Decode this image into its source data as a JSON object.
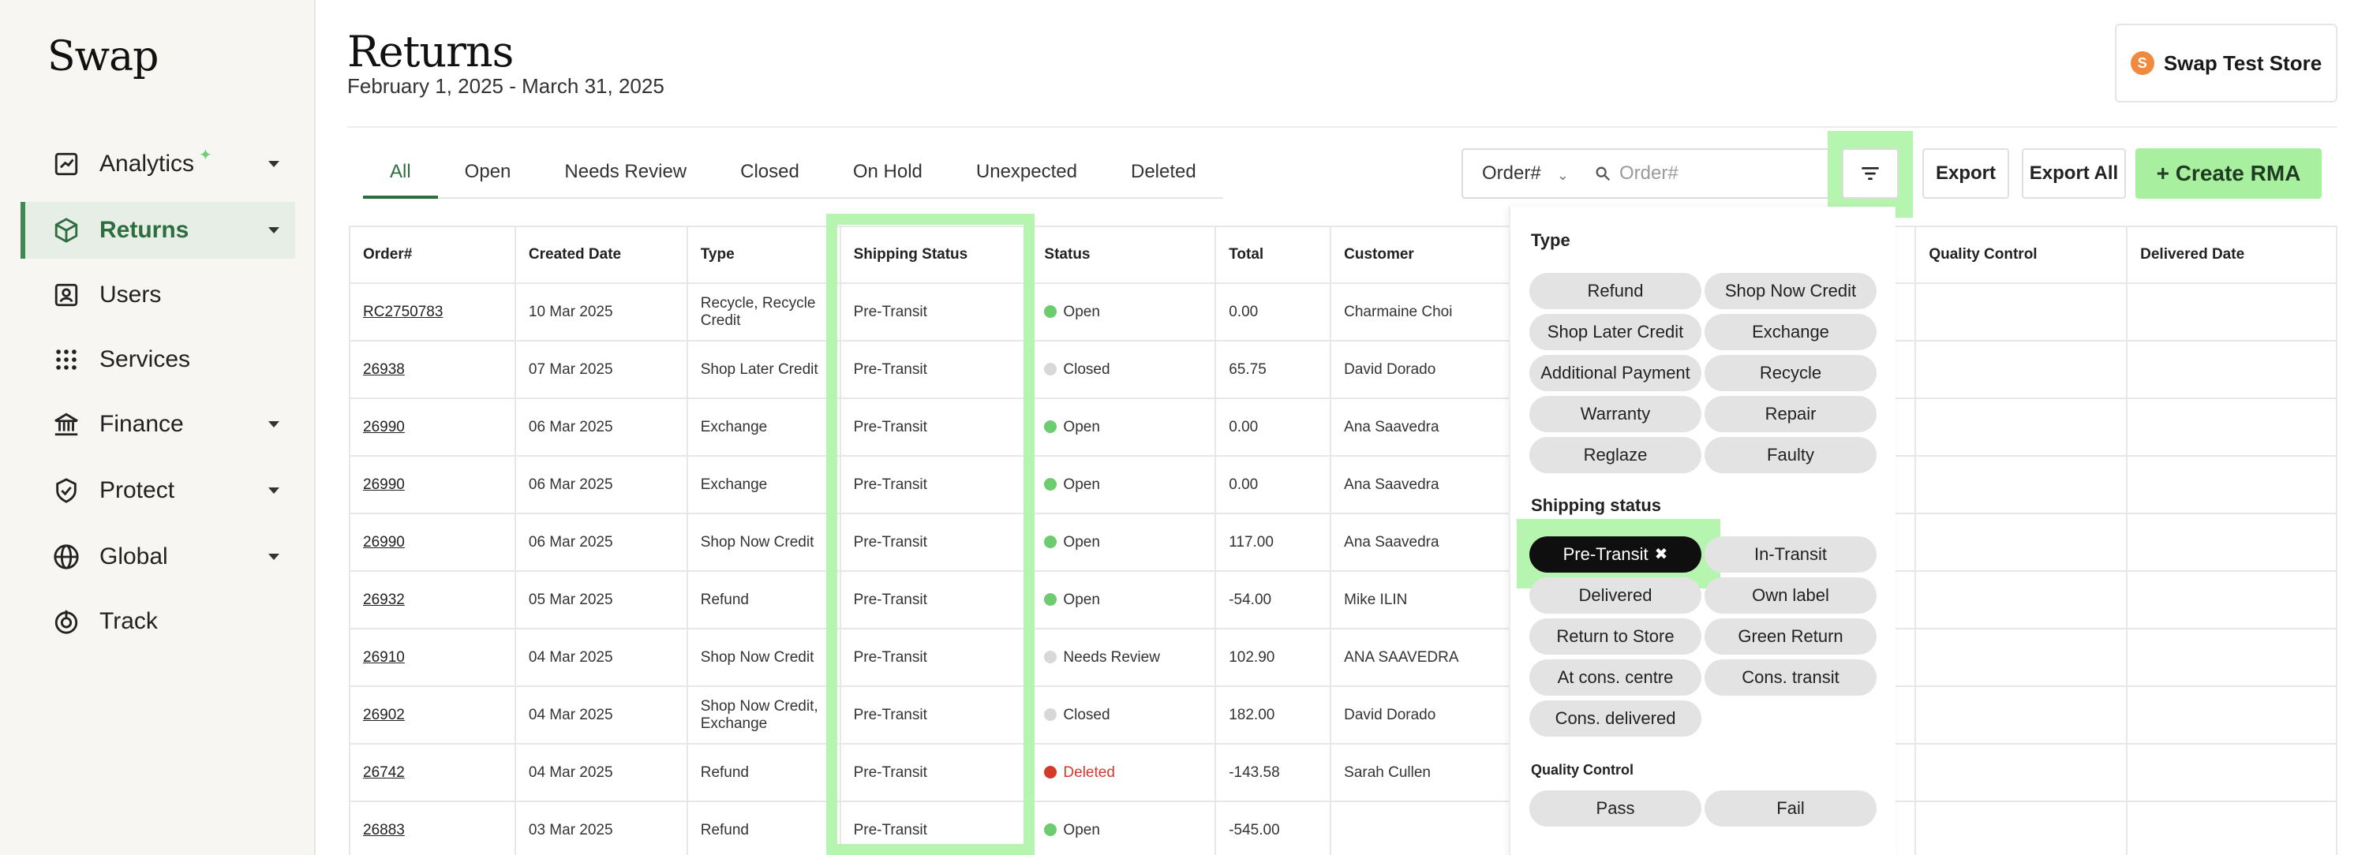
{
  "sidebar": {
    "logo": "Swap",
    "items": [
      {
        "label": "Analytics",
        "icon": "chart-icon",
        "caret": true
      },
      {
        "label": "Returns",
        "icon": "box-icon",
        "caret": true,
        "active": true
      },
      {
        "label": "Users",
        "icon": "user-icon",
        "caret": false
      },
      {
        "label": "Services",
        "icon": "grid-dots-icon",
        "caret": false
      },
      {
        "label": "Finance",
        "icon": "bank-icon",
        "caret": true
      },
      {
        "label": "Protect",
        "icon": "shield-icon",
        "caret": true
      },
      {
        "label": "Global",
        "icon": "globe-icon",
        "caret": true
      },
      {
        "label": "Track",
        "icon": "target-icon",
        "caret": false
      }
    ]
  },
  "header": {
    "title": "Returns",
    "date_range": "February 1, 2025 - March 31, 2025",
    "store": "Swap Test Store"
  },
  "tabs": [
    "All",
    "Open",
    "Needs Review",
    "Closed",
    "On Hold",
    "Unexpected",
    "Deleted"
  ],
  "toolbar": {
    "search_field": "Order#",
    "search_placeholder": "Order#",
    "export": "Export",
    "export_all": "Export All",
    "create": "+ Create RMA"
  },
  "table": {
    "columns": [
      "Order#",
      "Created Date",
      "Type",
      "Shipping Status",
      "Status",
      "Total",
      "Customer",
      "",
      "",
      "Quality Control",
      "Delivered Date"
    ],
    "rows": [
      {
        "order": "RC2750783",
        "date": "10 Mar 2025",
        "type": "Recycle, Recycle Credit",
        "shipping": "Pre-Transit",
        "status": "Open",
        "total": "0.00",
        "customer": "Charmaine Choi"
      },
      {
        "order": "26938",
        "date": "07 Mar 2025",
        "type": "Shop Later Credit",
        "shipping": "Pre-Transit",
        "status": "Closed",
        "total": "65.75",
        "customer": "David Dorado"
      },
      {
        "order": "26990",
        "date": "06 Mar 2025",
        "type": "Exchange",
        "shipping": "Pre-Transit",
        "status": "Open",
        "total": "0.00",
        "customer": "Ana Saavedra"
      },
      {
        "order": "26990",
        "date": "06 Mar 2025",
        "type": "Exchange",
        "shipping": "Pre-Transit",
        "status": "Open",
        "total": "0.00",
        "customer": "Ana Saavedra"
      },
      {
        "order": "26990",
        "date": "06 Mar 2025",
        "type": "Shop Now Credit",
        "shipping": "Pre-Transit",
        "status": "Open",
        "total": "117.00",
        "customer": "Ana Saavedra"
      },
      {
        "order": "26932",
        "date": "05 Mar 2025",
        "type": "Refund",
        "shipping": "Pre-Transit",
        "status": "Open",
        "total": "-54.00",
        "customer": "Mike ILIN"
      },
      {
        "order": "26910",
        "date": "04 Mar 2025",
        "type": "Shop Now Credit",
        "shipping": "Pre-Transit",
        "status": "Needs Review",
        "total": "102.90",
        "customer": "ANA SAAVEDRA"
      },
      {
        "order": "26902",
        "date": "04 Mar 2025",
        "type": "Shop Now Credit, Exchange",
        "shipping": "Pre-Transit",
        "status": "Closed",
        "total": "182.00",
        "customer": "David Dorado"
      },
      {
        "order": "26742",
        "date": "04 Mar 2025",
        "type": "Refund",
        "shipping": "Pre-Transit",
        "status": "Deleted",
        "total": "-143.58",
        "customer": "Sarah Cullen"
      },
      {
        "order": "26883",
        "date": "03 Mar 2025",
        "type": "Refund",
        "shipping": "Pre-Transit",
        "status": "Open",
        "total": "-545.00",
        "customer": ""
      }
    ]
  },
  "filter_panel": {
    "type_heading": "Type",
    "type_chips": [
      "Refund",
      "Shop Now Credit",
      "Shop Later Credit",
      "Exchange",
      "Additional Payment",
      "Recycle",
      "Warranty",
      "Repair",
      "Reglaze",
      "Faulty"
    ],
    "shipping_heading": "Shipping status",
    "shipping_chips": [
      "Pre-Transit",
      "In-Transit",
      "Delivered",
      "Own label",
      "Return to Store",
      "Green Return",
      "At cons. centre",
      "Cons. transit",
      "Cons. delivered"
    ],
    "selected_shipping": "Pre-Transit",
    "qc_heading": "Quality Control",
    "qc_chips": [
      "Pass",
      "Fail"
    ]
  },
  "colors": {
    "accent_green": "#2e6d40",
    "highlight": "#b6f5b0",
    "create_button": "#a8f0a0",
    "status_open": "#6ccc6e",
    "status_deleted": "#d43a2a"
  }
}
